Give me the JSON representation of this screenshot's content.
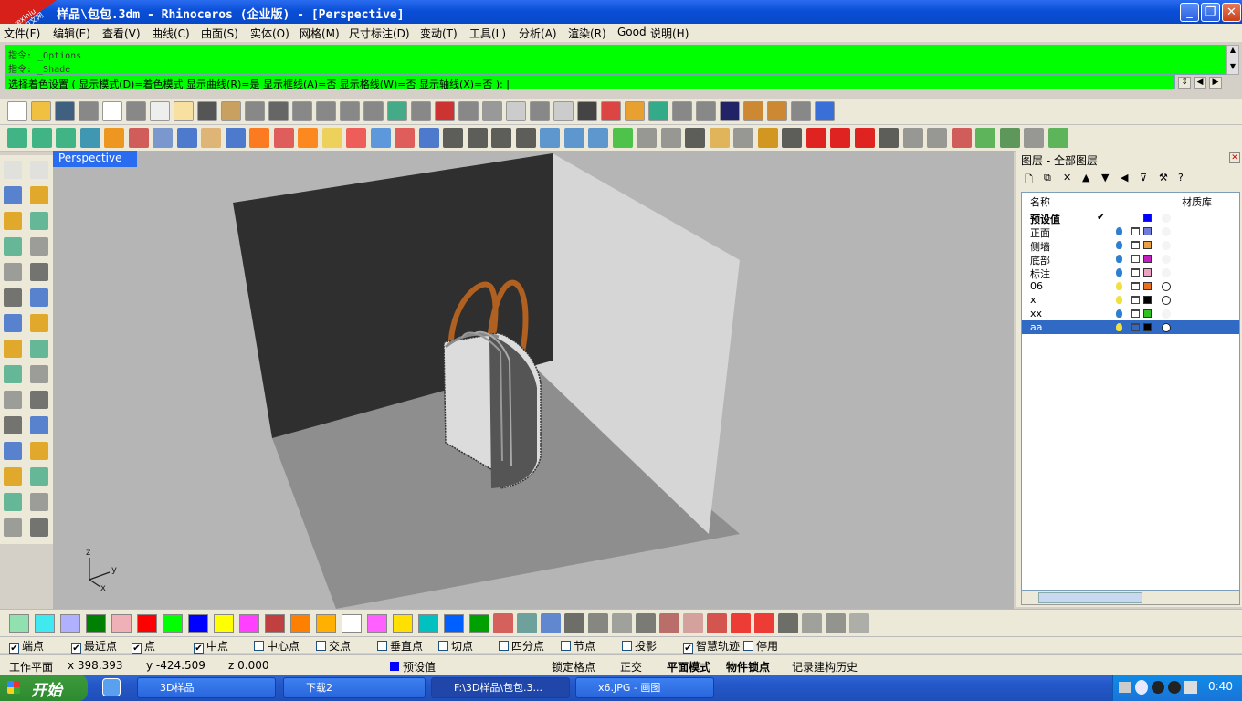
{
  "window": {
    "title": "样品\\包包.3dm - Rhinoceros (企业版) - [Perspective]",
    "min_label": "_",
    "max_label": "❐",
    "close_label": "✕"
  },
  "watermark": {
    "line1": "xuexiniu",
    "line2": "学犀牛中文网"
  },
  "menu": [
    "文件(F)",
    "编辑(E)",
    "查看(V)",
    "曲线(C)",
    "曲面(S)",
    "实体(O)",
    "网格(M)",
    "尺寸标注(D)",
    "变动(T)",
    "工具(L)",
    "分析(A)",
    "渲染(R)",
    "Good",
    "说明(H)"
  ],
  "command": {
    "history": [
      "指令: _Options",
      "指令: _Shade"
    ],
    "prompt": "选择着色设置 ( 显示模式(D)=着色模式  显示曲线(R)=是  显示框线(A)=否  显示格线(W)=否  显示轴线(X)=否 ): |"
  },
  "viewport": {
    "tab_label": "Perspective",
    "axis_labels": {
      "z": "z",
      "y": "y",
      "x": "x"
    }
  },
  "layers": {
    "panel_title": "图层 - 全部图层",
    "close_label": "✕",
    "toolbar": [
      "🗋",
      "⧉",
      "✕",
      "▲",
      "▼",
      "◀",
      "⊽",
      "⚒",
      "?"
    ],
    "columns": {
      "name": "名称",
      "material": "材质库"
    },
    "rows": [
      {
        "name": "预设值",
        "current": "✔",
        "color": "#0000ff",
        "bulb": "",
        "material": "empty"
      },
      {
        "name": "正面",
        "color": "#6f7bd8",
        "bulb": "#2f7fd0",
        "material": "empty"
      },
      {
        "name": "侧墙",
        "color": "#e8a040",
        "bulb": "#2f7fd0",
        "material": "empty"
      },
      {
        "name": "底部",
        "color": "#c020c0",
        "bulb": "#2f7fd0",
        "material": "empty"
      },
      {
        "name": "标注",
        "color": "#f0a0c0",
        "bulb": "#2f7fd0",
        "material": "empty"
      },
      {
        "name": "06",
        "color": "#e87020",
        "bulb": "#f0e040",
        "material": "ring"
      },
      {
        "name": "x",
        "color": "#000000",
        "bulb": "#f0e040",
        "material": "ring"
      },
      {
        "name": "xx",
        "color": "#30c020",
        "bulb": "#2f7fd0",
        "material": "empty"
      },
      {
        "name": "aa",
        "color": "#000000",
        "bulb": "#f0e040",
        "material": "ring",
        "selected": true
      }
    ]
  },
  "color_swatches": [
    "#90e0b0",
    "#40e8f0",
    "#b0b0ff",
    "#008000",
    "#f0b0b8",
    "#ff0000",
    "#00ff00",
    "#0000ff",
    "#ffff00",
    "#ff40ff",
    "#c04040",
    "#ff8000",
    "#ffb000",
    "#ffffff",
    "#ff60ff",
    "#ffe000",
    "#00c0c0",
    "#0060ff",
    "#00a000"
  ],
  "osnaps": [
    {
      "label": "端点",
      "checked": true
    },
    {
      "label": "最近点",
      "checked": true
    },
    {
      "label": "点",
      "checked": true
    },
    {
      "label": "中点",
      "checked": true
    },
    {
      "label": "中心点",
      "checked": false
    },
    {
      "label": "交点",
      "checked": false
    },
    {
      "label": "垂直点",
      "checked": false
    },
    {
      "label": "切点",
      "checked": false
    },
    {
      "label": "四分点",
      "checked": false
    },
    {
      "label": "节点",
      "checked": false
    },
    {
      "label": "投影",
      "checked": false
    },
    {
      "label": "智慧轨迹",
      "checked": true
    },
    {
      "label": "停用",
      "checked": false
    }
  ],
  "status": {
    "plane": "工作平面",
    "x": "x 398.393",
    "y": "y -424.509",
    "z": "z 0.000",
    "layer": "预设值",
    "grid_snap": "锁定格点",
    "ortho": "正交",
    "planar": "平面模式",
    "object_snap": "物件锁点",
    "history": "记录建构历史"
  },
  "taskbar": {
    "start": "开始",
    "tasks": [
      "3D样品",
      "下载2",
      "F:\\3D样品\\包包.3...",
      "x6.JPG - 画图"
    ],
    "time": "0:40"
  }
}
